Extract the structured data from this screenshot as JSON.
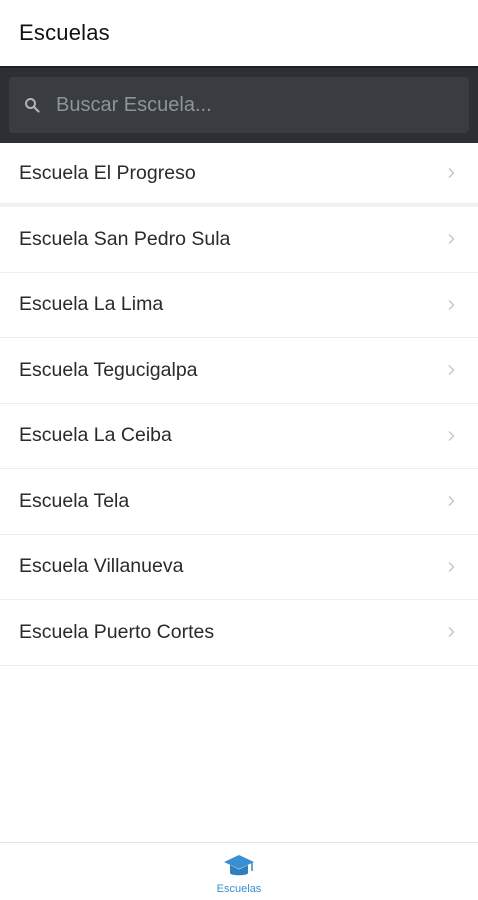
{
  "header": {
    "title": "Escuelas"
  },
  "search": {
    "placeholder": "Buscar Escuela...",
    "value": "",
    "icon": "search-icon"
  },
  "schools": [
    {
      "label": "Escuela El Progreso"
    },
    {
      "label": "Escuela San Pedro Sula"
    },
    {
      "label": "Escuela La Lima"
    },
    {
      "label": "Escuela Tegucigalpa"
    },
    {
      "label": "Escuela La Ceiba"
    },
    {
      "label": "Escuela Tela"
    },
    {
      "label": "Escuela Villanueva"
    },
    {
      "label": "Escuela Puerto Cortes"
    }
  ],
  "bottom_nav": {
    "tabs": [
      {
        "label": "Escuelas",
        "icon": "graduation-cap-icon",
        "active": true
      }
    ]
  },
  "colors": {
    "search_bar_bg": "#2c2f33",
    "accent": "#3a8fd0"
  }
}
